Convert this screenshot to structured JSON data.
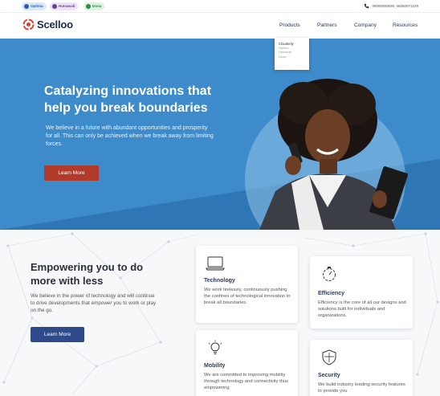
{
  "topbar": {
    "badges": [
      "Optima",
      "Humanali",
      "Dona"
    ],
    "phone": "08060000836, 08060071229"
  },
  "nav": {
    "brand": "Scelloo",
    "items": [
      "Products",
      "Partners",
      "Company",
      "Resources"
    ],
    "products_dropdown": [
      "Cloudenly",
      "Optima",
      "Humanali",
      "Dona"
    ]
  },
  "hero": {
    "title": "Catalyzing innovations that help you break boundaries",
    "text": "We believe in a future with abundant opportunities and prosperity for all. This can only be achieved when we break away from limiting forces.",
    "cta": "Learn More"
  },
  "about": {
    "title": "Empowering you to do more with less",
    "text": "We believe in the power of technology and will continue to drive developments that empower you to work or play on the go.",
    "cta": "Learn More"
  },
  "cards": [
    {
      "icon": "laptop-icon",
      "title": "Technology",
      "text": "We work tirelessly, continuously pushing the confines of technological innovation to break all boundaries."
    },
    {
      "icon": "stopwatch-icon",
      "title": "Efficiency",
      "text": "Efficiency is the core of all our designs and solutions built for individuals and organizations."
    },
    {
      "icon": "lightbulb-icon",
      "title": "Mobility",
      "text": "We are committed to improving mobility through technology and connectivity thus empowering"
    },
    {
      "icon": "shield-icon",
      "title": "Security",
      "text": "We build industry leading security features to provide you"
    }
  ],
  "colors": {
    "hero_bg": "#3a86c4",
    "hero_cta": "#b23a2a",
    "about_cta": "#2e4a8a",
    "brand_red": "#e03a2a"
  }
}
